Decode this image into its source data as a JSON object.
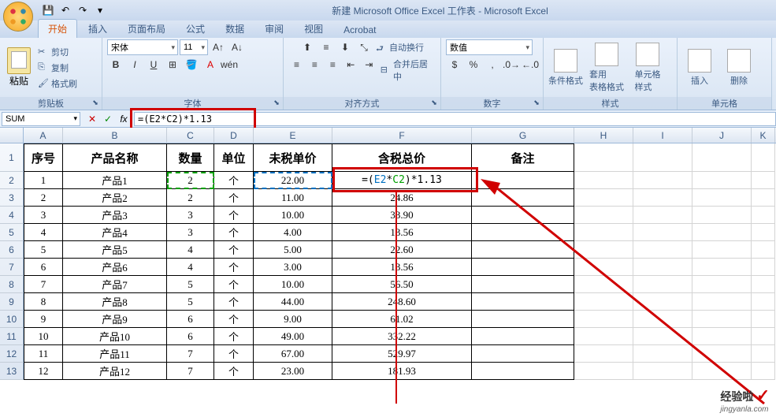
{
  "title": "新建 Microsoft Office Excel 工作表 - Microsoft Excel",
  "tabs": [
    "开始",
    "插入",
    "页面布局",
    "公式",
    "数据",
    "审阅",
    "视图",
    "Acrobat"
  ],
  "clipboard": {
    "paste": "粘贴",
    "cut": "剪切",
    "copy": "复制",
    "painter": "格式刷",
    "label": "剪贴板"
  },
  "font": {
    "name": "宋体",
    "size": "11",
    "label": "字体"
  },
  "align": {
    "wrap": "自动换行",
    "merge": "合并后居中",
    "label": "对齐方式"
  },
  "number": {
    "format": "数值",
    "label": "数字"
  },
  "styles": {
    "cond": "条件格式",
    "table": "套用\n表格格式",
    "cell": "单元格\n样式",
    "label": "样式"
  },
  "cells": {
    "insert": "插入",
    "delete": "删除",
    "label": "单元格"
  },
  "namebox": "SUM",
  "formula": "=(E2*C2)*1.13",
  "formula_colored": {
    "eq": "=(",
    "r1": "E2",
    "s1": "*",
    "r2": "C2",
    "tail": ")*1.13"
  },
  "cols": [
    "A",
    "B",
    "C",
    "D",
    "E",
    "F",
    "G",
    "H",
    "I",
    "J",
    "K"
  ],
  "headers": [
    "序号",
    "产品名称",
    "数量",
    "单位",
    "未税单价",
    "含税总价",
    "备注"
  ],
  "chart_data": {
    "type": "table",
    "columns": [
      "序号",
      "产品名称",
      "数量",
      "单位",
      "未税单价",
      "含税总价",
      "备注"
    ],
    "rows": [
      [
        1,
        "产品1",
        2,
        "个",
        22.0,
        "=(E2*C2)*1.13",
        ""
      ],
      [
        2,
        "产品2",
        2,
        "个",
        11.0,
        24.86,
        ""
      ],
      [
        3,
        "产品3",
        3,
        "个",
        10.0,
        33.9,
        ""
      ],
      [
        4,
        "产品4",
        3,
        "个",
        4.0,
        13.56,
        ""
      ],
      [
        5,
        "产品5",
        4,
        "个",
        5.0,
        22.6,
        ""
      ],
      [
        6,
        "产品6",
        4,
        "个",
        3.0,
        13.56,
        ""
      ],
      [
        7,
        "产品7",
        5,
        "个",
        10.0,
        56.5,
        ""
      ],
      [
        8,
        "产品8",
        5,
        "个",
        44.0,
        248.6,
        ""
      ],
      [
        9,
        "产品9",
        6,
        "个",
        9.0,
        61.02,
        ""
      ],
      [
        10,
        "产品10",
        6,
        "个",
        49.0,
        332.22,
        ""
      ],
      [
        11,
        "产品11",
        7,
        "个",
        67.0,
        529.97,
        ""
      ],
      [
        12,
        "产品12",
        7,
        "个",
        23.0,
        181.93,
        ""
      ]
    ]
  },
  "rows": [
    {
      "n": "1",
      "a": "1",
      "b": "产品1",
      "c": "2",
      "d": "个",
      "e": "22.00",
      "f": "=(E2*C2)*1.13",
      "g": ""
    },
    {
      "n": "2",
      "a": "2",
      "b": "产品2",
      "c": "2",
      "d": "个",
      "e": "11.00",
      "f": "24.86",
      "g": ""
    },
    {
      "n": "3",
      "a": "3",
      "b": "产品3",
      "c": "3",
      "d": "个",
      "e": "10.00",
      "f": "33.90",
      "g": ""
    },
    {
      "n": "4",
      "a": "4",
      "b": "产品4",
      "c": "3",
      "d": "个",
      "e": "4.00",
      "f": "13.56",
      "g": ""
    },
    {
      "n": "5",
      "a": "5",
      "b": "产品5",
      "c": "4",
      "d": "个",
      "e": "5.00",
      "f": "22.60",
      "g": ""
    },
    {
      "n": "6",
      "a": "6",
      "b": "产品6",
      "c": "4",
      "d": "个",
      "e": "3.00",
      "f": "13.56",
      "g": ""
    },
    {
      "n": "7",
      "a": "7",
      "b": "产品7",
      "c": "5",
      "d": "个",
      "e": "10.00",
      "f": "56.50",
      "g": ""
    },
    {
      "n": "8",
      "a": "8",
      "b": "产品8",
      "c": "5",
      "d": "个",
      "e": "44.00",
      "f": "248.60",
      "g": ""
    },
    {
      "n": "9",
      "a": "9",
      "b": "产品9",
      "c": "6",
      "d": "个",
      "e": "9.00",
      "f": "61.02",
      "g": ""
    },
    {
      "n": "10",
      "a": "10",
      "b": "产品10",
      "c": "6",
      "d": "个",
      "e": "49.00",
      "f": "332.22",
      "g": ""
    },
    {
      "n": "11",
      "a": "11",
      "b": "产品11",
      "c": "7",
      "d": "个",
      "e": "67.00",
      "f": "529.97",
      "g": ""
    },
    {
      "n": "12",
      "a": "12",
      "b": "产品12",
      "c": "7",
      "d": "个",
      "e": "23.00",
      "f": "181.93",
      "g": ""
    }
  ],
  "watermark": {
    "brand": "经验啦",
    "url": "jingyanla.com"
  }
}
